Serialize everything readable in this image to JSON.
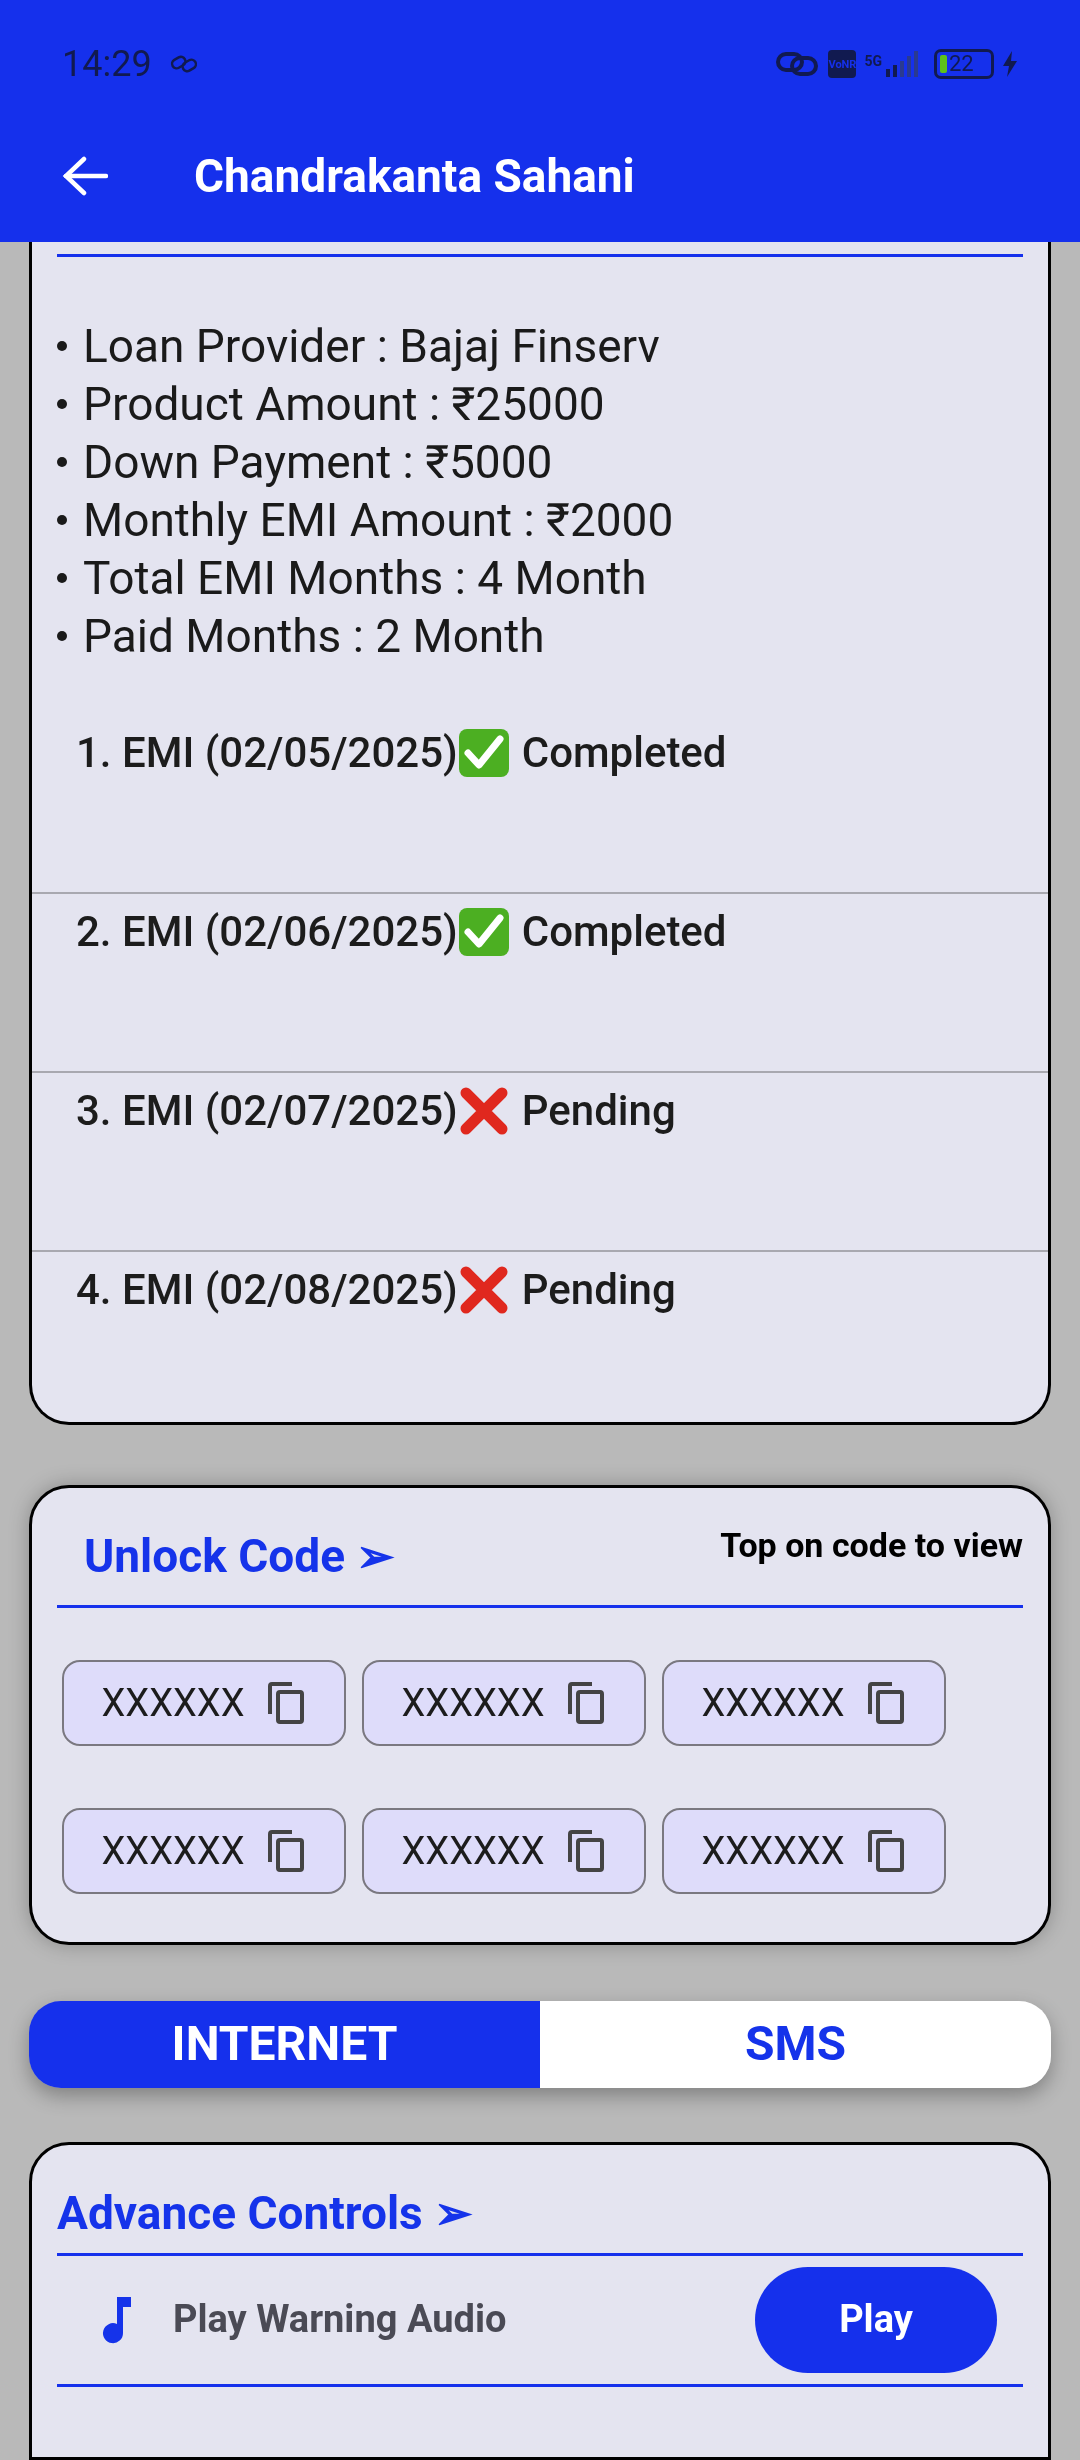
{
  "status_bar": {
    "time": "14:29",
    "network": "5G",
    "volte": "VoNR",
    "battery": "22"
  },
  "app_bar": {
    "title": "Chandrakanta Sahani"
  },
  "loan_details": [
    "Loan Provider : Bajaj Finserv",
    "Product Amount : ₹25000",
    "Down Payment : ₹5000",
    "Monthly EMI Amount : ₹2000",
    "Total EMI Months : 4 Month",
    "Paid Months : 2 Month"
  ],
  "emis": [
    {
      "label": "1. EMI (02/05/2025)",
      "paid": true,
      "status": "Completed"
    },
    {
      "label": "2. EMI (02/06/2025)",
      "paid": true,
      "status": "Completed"
    },
    {
      "label": "3. EMI (02/07/2025)",
      "paid": false,
      "status": "Pending"
    },
    {
      "label": "4. EMI (02/08/2025)",
      "paid": false,
      "status": "Pending"
    }
  ],
  "unlock_code": {
    "title": "Unlock Code ➢",
    "hint": "Top on code to view",
    "codes": [
      "XXXXXX",
      "XXXXXX",
      "XXXXXX",
      "XXXXXX",
      "XXXXXX",
      "XXXXXX"
    ]
  },
  "mode_tabs": [
    {
      "label": "INTERNET",
      "selected": true
    },
    {
      "label": "SMS",
      "selected": false
    }
  ],
  "advance_controls": {
    "title": "Advance Controls ➢",
    "items": [
      {
        "label": "Play Warning Audio",
        "button": "Play"
      }
    ]
  }
}
